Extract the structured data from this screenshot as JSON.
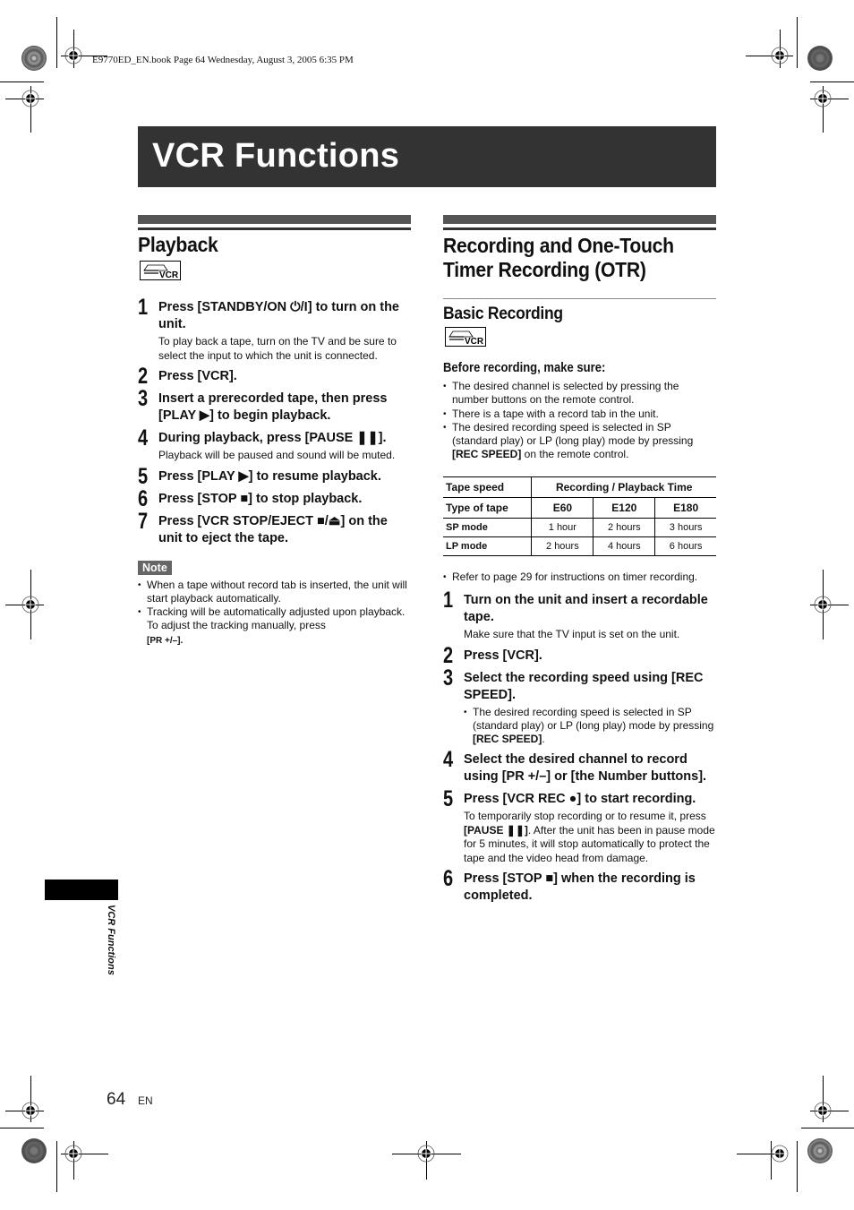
{
  "print_header": "E9770ED_EN.book  Page 64  Wednesday, August 3, 2005  6:35 PM",
  "page_title": "VCR Functions",
  "playback": {
    "title": "Playback",
    "icon": "vcr-icon",
    "icon_label": "VCR",
    "steps": [
      {
        "num": "1",
        "text": "Press [STANDBY/ON ⏻/I] to turn on the unit.",
        "note": "To play back a tape, turn on the TV and be sure to select the input to which the unit is connected."
      },
      {
        "num": "2",
        "text": "Press [VCR].",
        "note": ""
      },
      {
        "num": "3",
        "text": "Insert a prerecorded tape, then press [PLAY ▶] to begin playback.",
        "note": ""
      },
      {
        "num": "4",
        "text": "During playback, press [PAUSE ❚❚].",
        "note": "Playback will be paused and sound will be muted."
      },
      {
        "num": "5",
        "text": "Press [PLAY ▶] to resume playback.",
        "note": ""
      },
      {
        "num": "6",
        "text": "Press [STOP ■] to stop playback.",
        "note": ""
      },
      {
        "num": "7",
        "text": "Press [VCR STOP/EJECT ■/⏏] on the unit to eject the tape.",
        "note": ""
      }
    ],
    "note_label": "Note",
    "notes": [
      "When a tape without record tab is inserted, the unit will start playback automatically.",
      "Tracking will be automatically adjusted upon playback. To adjust the tracking manually, press"
    ],
    "notes_tail": "[PR +/–]."
  },
  "recording": {
    "title": "Recording and One-Touch Timer Recording (OTR)",
    "subtitle": "Basic Recording",
    "icon_label": "VCR",
    "before_label": "Before recording, make sure:",
    "before_items": [
      "The desired channel is selected by pressing the number buttons on the remote control.",
      "There is a tape with a record tab in the unit.",
      "The desired recording speed is selected in SP (standard play) or LP (long play) mode by pressing"
    ],
    "before_tail_bold": "[REC SPEED]",
    "before_tail": " on the remote control.",
    "table": {
      "header1": [
        "Tape speed",
        "Recording / Playback Time"
      ],
      "header2": [
        "Type of tape",
        "E60",
        "E120",
        "E180"
      ],
      "rows": [
        [
          "SP mode",
          "1 hour",
          "2 hours",
          "3 hours"
        ],
        [
          "LP mode",
          "2 hours",
          "4 hours",
          "6 hours"
        ]
      ]
    },
    "refer_note": "Refer to page 29 for instructions on timer recording.",
    "steps": [
      {
        "num": "1",
        "text": "Turn on the unit and insert a recordable tape.",
        "note": "Make sure that the TV input is set on the unit."
      },
      {
        "num": "2",
        "text": "Press [VCR].",
        "note": ""
      },
      {
        "num": "3",
        "text": "Select the recording speed using [REC SPEED].",
        "note": ""
      },
      {
        "num": "4",
        "text": "Select the desired channel to record using [PR +/–] or [the Number buttons].",
        "note": ""
      },
      {
        "num": "5",
        "text": "Press [VCR REC ●] to start recording.",
        "note": ""
      },
      {
        "num": "6",
        "text": "Press [STOP ■] when the recording is completed.",
        "note": ""
      }
    ],
    "step3_bullet": "The desired recording speed is selected in SP (standard play) or LP (long play) mode by pressing",
    "step3_bullet_bold": "[REC SPEED]",
    "step5_note_a": "To temporarily stop recording or to resume it, press ",
    "step5_note_bold": "[PAUSE ❚❚]",
    "step5_note_b": ". After the unit has been in pause mode for 5 minutes, it will stop automatically to protect the tape and the video head from damage."
  },
  "side_tab_label": "VCR Functions",
  "footer": {
    "page_number": "64",
    "language": "EN"
  }
}
